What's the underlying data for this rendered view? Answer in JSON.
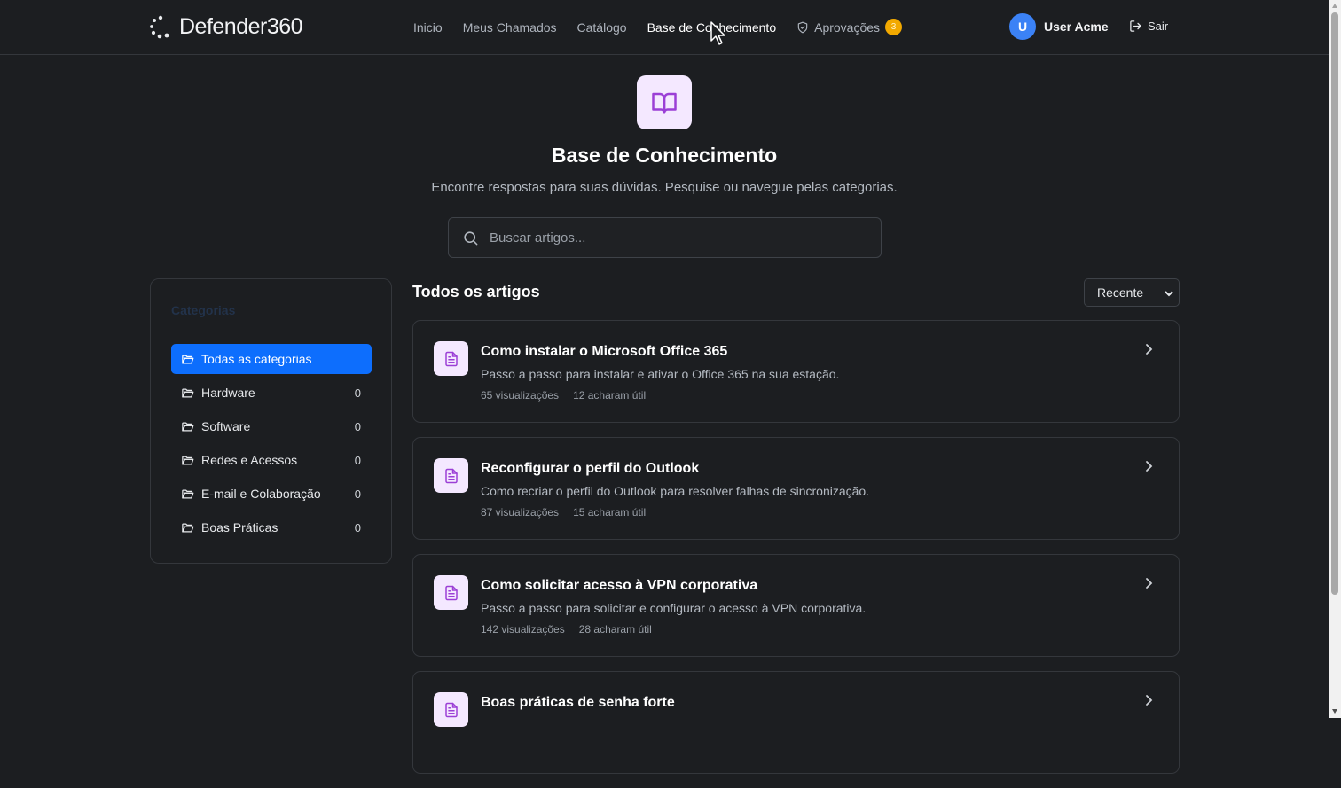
{
  "brand": {
    "name": "Defender360"
  },
  "nav": {
    "items": [
      {
        "label": "Inicio"
      },
      {
        "label": "Meus Chamados"
      },
      {
        "label": "Catálogo"
      },
      {
        "label": "Base de Conhecimento",
        "active": true
      },
      {
        "label": "Aprovações",
        "badge": "3"
      }
    ]
  },
  "user": {
    "initial": "U",
    "name": "User Acme",
    "logout_label": "Sair"
  },
  "hero": {
    "icon": "book-open-icon",
    "title": "Base de Conhecimento",
    "subtitle": "Encontre respostas para suas dúvidas. Pesquise ou navegue pelas categorias."
  },
  "search": {
    "placeholder": "Buscar artigos...",
    "value": ""
  },
  "sidebar": {
    "title": "Categorias",
    "categories": [
      {
        "label": "Todas as categorias",
        "active": true,
        "count": ""
      },
      {
        "label": "Hardware",
        "count": "0"
      },
      {
        "label": "Software",
        "count": "0"
      },
      {
        "label": "Redes e Acessos",
        "count": "0"
      },
      {
        "label": "E-mail e Colaboração",
        "count": "0"
      },
      {
        "label": "Boas Práticas",
        "count": "0"
      }
    ]
  },
  "main": {
    "section_title": "Todos os artigos",
    "sort": {
      "selected": "Recente"
    },
    "articles": [
      {
        "title": "Como instalar o Microsoft Office 365",
        "description": "Passo a passo para instalar e ativar o Office 365 na sua estação.",
        "views": "65 visualizações",
        "helpful": "12 acharam útil"
      },
      {
        "title": "Reconfigurar o perfil do Outlook",
        "description": "Como recriar o perfil do Outlook para resolver falhas de sincronização.",
        "views": "87 visualizações",
        "helpful": "15 acharam útil"
      },
      {
        "title": "Como solicitar acesso à VPN corporativa",
        "description": "Passo a passo para solicitar e configurar o acesso à VPN corporativa.",
        "views": "142 visualizações",
        "helpful": "28 acharam útil"
      },
      {
        "title": "Boas práticas de senha forte",
        "description": "",
        "views": "",
        "helpful": ""
      }
    ]
  },
  "colors": {
    "background": "#1c1e21",
    "accent": "#0d6efd",
    "badge": "#f2a900",
    "avatar": "#3b82f6",
    "icon_bg": "#f4e8ff",
    "icon_fg": "#9b3fd6"
  }
}
